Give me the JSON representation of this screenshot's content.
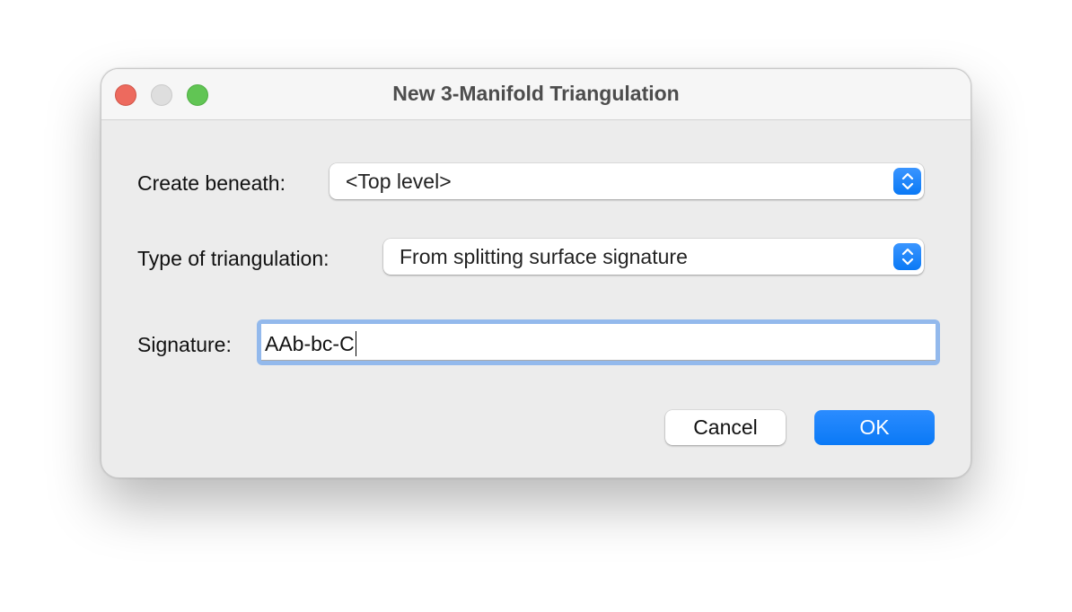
{
  "window": {
    "title": "New 3-Manifold Triangulation"
  },
  "form": {
    "create_beneath": {
      "label": "Create beneath:",
      "value": "<Top level>"
    },
    "type": {
      "label": "Type of triangulation:",
      "value": "From splitting surface signature"
    },
    "signature": {
      "label": "Signature:",
      "value": "AAb-bc-C"
    }
  },
  "buttons": {
    "cancel": "Cancel",
    "ok": "OK"
  },
  "colors": {
    "accent": "#0a79f6",
    "close": "#ed6a5e",
    "maximize": "#61c554",
    "focus_ring": "#93b9ec"
  }
}
